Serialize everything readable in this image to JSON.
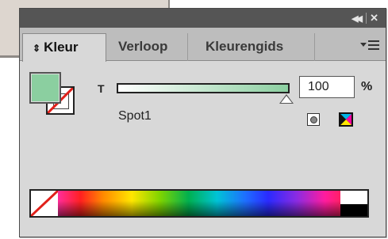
{
  "panel": {
    "tabs": [
      {
        "label": "Kleur",
        "active": true
      },
      {
        "label": "Verloop",
        "active": false
      },
      {
        "label": "Kleurengids",
        "active": false
      }
    ]
  },
  "color": {
    "tint_label": "T",
    "tint_value": "100",
    "tint_unit": "%",
    "swatch_name": "Spot1",
    "fill_color": "#8bcfa0"
  },
  "icons": {
    "collapse": "double-left-arrow-icon",
    "close": "close-icon",
    "panel_menu": "panel-menu-icon",
    "spot": "spot-color-icon",
    "cmyk": "cmyk-icon"
  }
}
